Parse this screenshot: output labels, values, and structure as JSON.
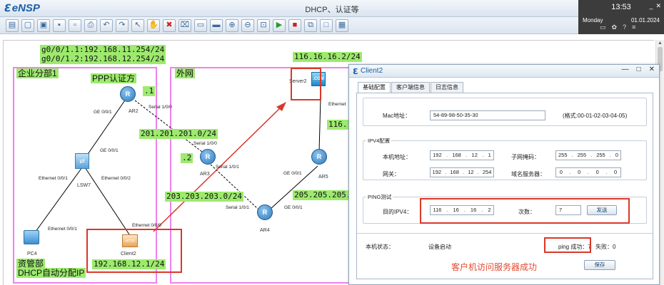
{
  "app": {
    "logo_text": "eNSP",
    "window_title": "DHCP、认证等"
  },
  "clock": {
    "time": "13:53",
    "day": "Monday",
    "date": "01.01.2024"
  },
  "toolbar": {
    "icons": [
      "new-topo-icon",
      "new-icon",
      "open-icon",
      "save-icon",
      "save-as-icon",
      "print-icon",
      "undo-icon",
      "redo-icon",
      "select-icon",
      "pan-icon",
      "delete-icon",
      "delete-links-icon",
      "text-icon",
      "rectangle-icon",
      "zoom-in-icon",
      "zoom-out-icon",
      "fit-icon",
      "start-icon",
      "stop-icon",
      "capture-icon",
      "topo-icon",
      "console-icon"
    ]
  },
  "topology": {
    "zone_branch": "企业分部1",
    "zone_wan": "外网",
    "zone_dept": "资管部",
    "ppp_auth": "PPP认证方",
    "dhcp_note": "DHCP自动分配IP",
    "ar2_if1": "g0/0/1.1:192.168.11.254/24",
    "ar2_if2": "g0/0/1.2:192.168.12.254/24",
    "ip_server": "116.16.16.2/24",
    "ip_dot1": ".1",
    "ip_dot2": ".2",
    "ip_201": "201.201.201.0/24",
    "ip_203": "203.203.203.0/24",
    "ip_205": "205.205.205.",
    "ip_116_partial": "116.1",
    "ip_client": "192.168.12.1/24",
    "devices": {
      "ar2": "AR2",
      "ar3": "AR3",
      "ar4": "AR4",
      "ar5": "AR5",
      "lsw7": "LSW7",
      "pc4": "PC4",
      "client2": "Client2",
      "server2": "Server2"
    },
    "ifaces": {
      "ar2_ge001": "GE 0/0/1",
      "ar2_serial": "Serial 1/0/0",
      "lsw7_ge001": "GE 0/0/1",
      "lsw7_eth001": "Ethernet 0/0/1",
      "lsw7_eth002": "Ethernet 0/0/2",
      "pc4_eth": "Ethernet 0/0/1",
      "client2_eth": "Ethernet 0/0/0",
      "ar3_serial100": "Serial 1/0/0",
      "ar3_serial101": "Serial 1/0/1",
      "ar4_serial": "Serial 1/0/1",
      "ar4_ge": "GE 0/0/1",
      "ar5_ge": "GE 0/0/1",
      "server_eth": "Ethernet"
    }
  },
  "dialog": {
    "title": "Client2",
    "tabs": [
      "基础配置",
      "客户端信息",
      "日志信息"
    ],
    "mac_label": "Mac地址：",
    "mac_value": "54-89-98-50-35-30",
    "mac_hint": "(格式:00-01-02-03-04-05)",
    "ipv4_group": "IPV4配置",
    "local_addr_label": "本机地址：",
    "local_addr": [
      "192",
      "168",
      "12",
      "1"
    ],
    "mask_label": "子网掩码：",
    "mask": [
      "255",
      "255",
      "255",
      "0"
    ],
    "gateway_label": "网关：",
    "gateway": [
      "192",
      "168",
      "12",
      "254"
    ],
    "dns_label": "域名服务器：",
    "dns": [
      "0",
      "0",
      "0",
      "0"
    ],
    "ping_group": "PING测试",
    "target_label": "目的IPV4：",
    "target": [
      "116",
      "16",
      "16",
      "2"
    ],
    "count_label": "次数：",
    "count_value": "7",
    "send_label": "发送",
    "state_label": "本机状态：",
    "state_value": "设备启动",
    "ping_success": "ping 成功：7",
    "fail_label": "失败：0",
    "annotation": "客户机访问服务器成功",
    "save_label": "保存"
  }
}
